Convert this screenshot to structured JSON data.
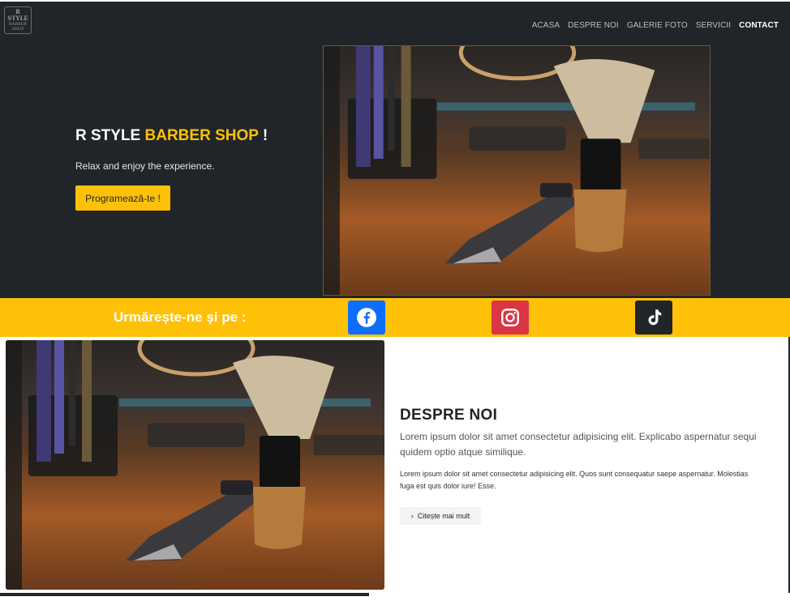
{
  "brand": {
    "logo_text": "R STYLE",
    "logo_sub": "BARBER SHOP"
  },
  "nav": {
    "items": [
      "ACASA",
      "DESPRE NOI",
      "GALERIE FOTO",
      "SERVICII",
      "CONTACT"
    ],
    "active": "CONTACT"
  },
  "hero": {
    "title_prefix": "R STYLE ",
    "title_accent": "BARBER SHOP",
    "title_suffix": " !",
    "subtitle": "Relax and enjoy the experience.",
    "cta": "Programează-te !",
    "image_alt": "barber tools"
  },
  "social": {
    "title": "Urmărește-ne și pe :",
    "links": [
      {
        "name": "facebook",
        "icon": "facebook-icon",
        "color": "#0d6efd"
      },
      {
        "name": "instagram",
        "icon": "instagram-icon",
        "color": "#dc3545"
      },
      {
        "name": "tiktok",
        "icon": "tiktok-icon",
        "color": "#212529"
      }
    ]
  },
  "about": {
    "title": "DESPRE NOI",
    "lead": "Lorem ipsum dolor sit amet consectetur adipisicing elit. Explicabo aspernatur sequi quidem optio atque similique.",
    "text": "Lorem ipsum dolor sit amet consectetur adipisicing elit. Quos sunt consequatur saepe aspernatur. Molestias fuga est quis dolor iure! Esse.",
    "more": "Citește mai mult"
  },
  "colors": {
    "dark": "#212529",
    "accent": "#ffc107",
    "facebook": "#0d6efd",
    "instagram": "#dc3545"
  }
}
